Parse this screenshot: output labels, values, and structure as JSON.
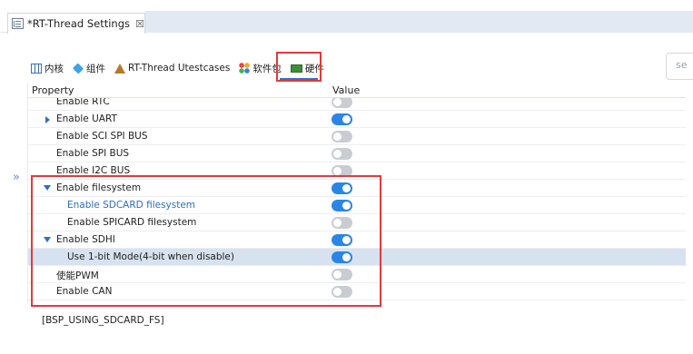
{
  "editor_tab": {
    "title": "*RT-Thread Settings",
    "close_glyph": "☒"
  },
  "search": {
    "placeholder": "se"
  },
  "category_tabs": [
    {
      "label": "内核",
      "icon": "grid-icon"
    },
    {
      "label": "组件",
      "icon": "cube-icon"
    },
    {
      "label": "RT-Thread Utestcases",
      "icon": "utest-icon"
    },
    {
      "label": "软件包",
      "icon": "packages-icon"
    },
    {
      "label": "硬件",
      "icon": "hardware-icon",
      "active": true
    }
  ],
  "table": {
    "col_property": "Property",
    "col_value": "Value",
    "rows": [
      {
        "label": "Enable RTC",
        "indent": 1,
        "expander": "none",
        "value": false
      },
      {
        "label": "Enable UART",
        "indent": 1,
        "expander": "collapsed",
        "value": true
      },
      {
        "label": "Enable SCI SPI BUS",
        "indent": 1,
        "expander": "none",
        "value": false
      },
      {
        "label": "Enable SPI BUS",
        "indent": 1,
        "expander": "none",
        "value": false
      },
      {
        "label": "Enable I2C BUS",
        "indent": 1,
        "expander": "none",
        "value": false
      },
      {
        "label": "Enable filesystem",
        "indent": 1,
        "expander": "expanded",
        "value": true
      },
      {
        "label": "Enable SDCARD filesystem",
        "indent": 2,
        "expander": "none",
        "value": true,
        "highlight": true
      },
      {
        "label": "Enable SPICARD filesystem",
        "indent": 2,
        "expander": "none",
        "value": false
      },
      {
        "label": "Enable SDHI",
        "indent": 1,
        "expander": "expanded",
        "value": true
      },
      {
        "label": "Use 1-bit Mode(4-bit when disable)",
        "indent": 2,
        "expander": "none",
        "value": true,
        "selected": true
      },
      {
        "label": "使能PWM",
        "indent": 1,
        "expander": "none",
        "value": false
      },
      {
        "label": "Enable CAN",
        "indent": 1,
        "expander": "none",
        "value": false
      }
    ]
  },
  "footer": {
    "macro": "[BSP_USING_SDCARD_FS]"
  },
  "colors": {
    "accent": "#2a86e6",
    "highlight_box": "#e03b3b",
    "selected_row": "#d7e2f1"
  }
}
